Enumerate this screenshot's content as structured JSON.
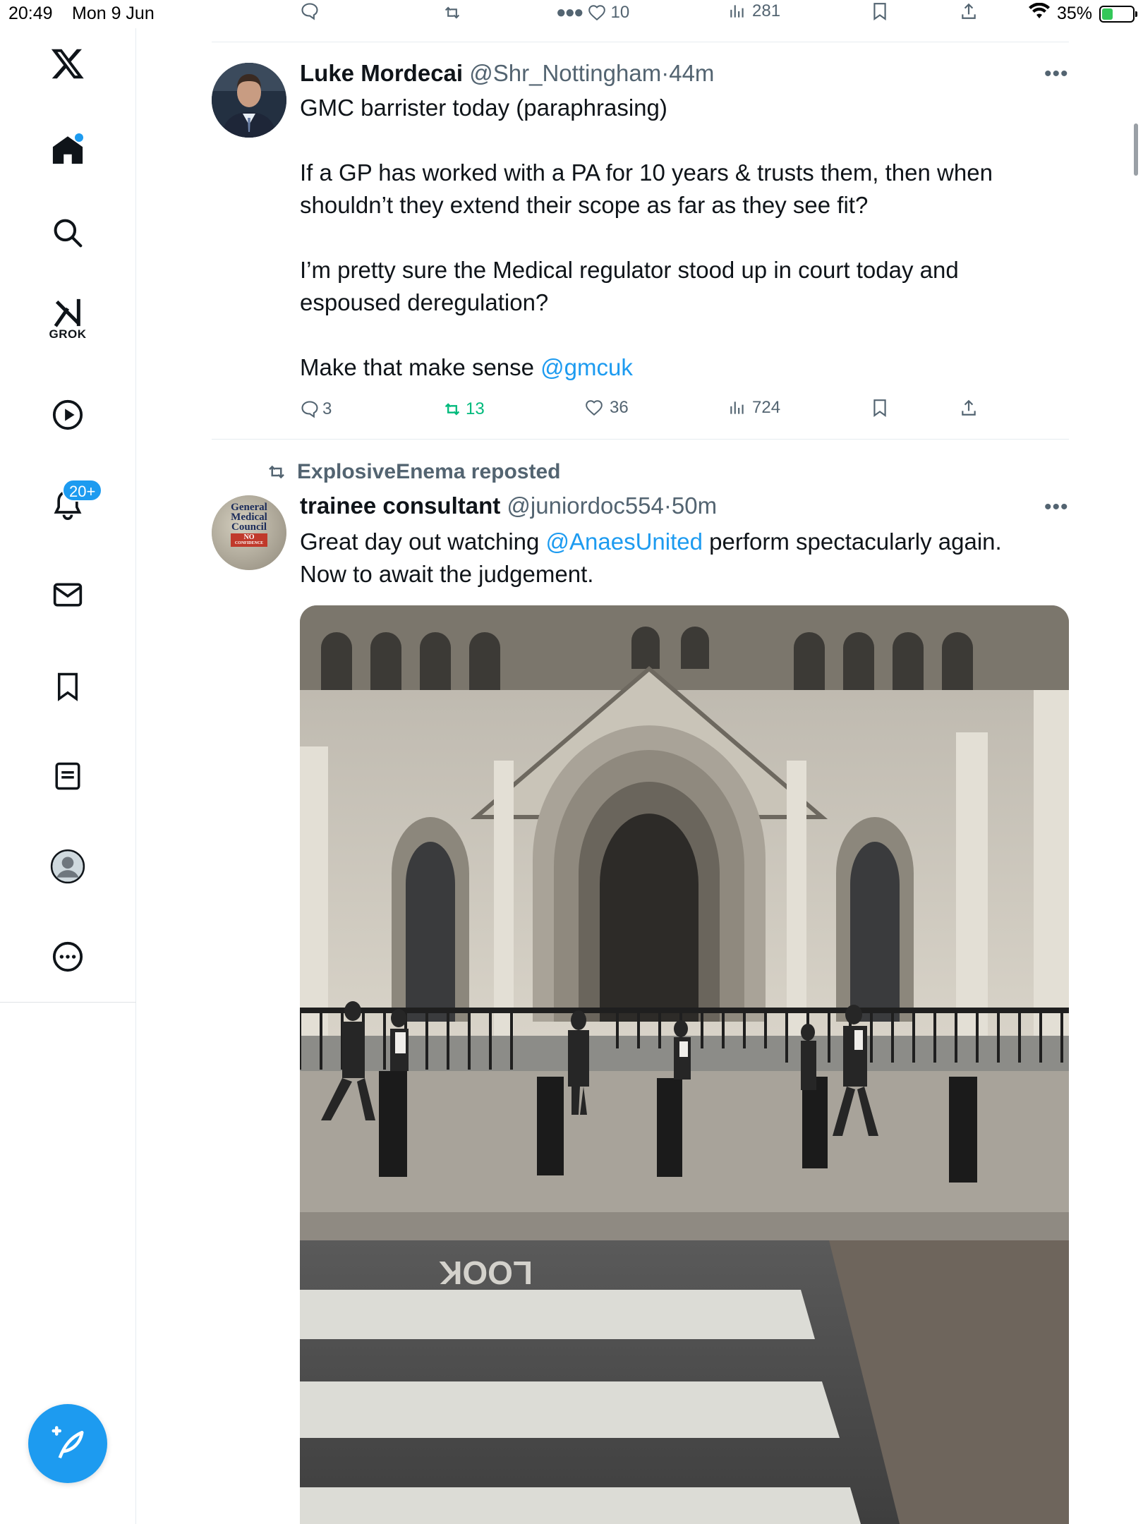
{
  "status_bar": {
    "time": "20:49",
    "date": "Mon 9 Jun",
    "battery": "35%",
    "battery_level": 0.35
  },
  "sidebar": {
    "items": [
      {
        "icon": "x-logo-icon"
      },
      {
        "icon": "home-icon",
        "has_dot": true
      },
      {
        "icon": "search-icon"
      },
      {
        "icon": "grok-icon",
        "label": "GROK"
      },
      {
        "icon": "video-icon"
      },
      {
        "icon": "notifications-icon",
        "badge": "20+"
      },
      {
        "icon": "messages-icon"
      },
      {
        "icon": "bookmarks-icon"
      },
      {
        "icon": "lists-icon"
      },
      {
        "icon": "profile-icon"
      },
      {
        "icon": "more-icon"
      }
    ],
    "compose_icon": "compose-icon"
  },
  "top_actions": {
    "likes": "10",
    "views": "281"
  },
  "tweets": [
    {
      "name": "Luke Mordecai",
      "handle": "@Shr_Nottingham",
      "dot": "·",
      "time": "44m",
      "text_main": "GMC barrister today (paraphrasing)\n\nIf a GP has worked with a PA for 10 years & trusts them, then when shouldn’t they extend their scope as far as they see fit?\n\nI’m pretty sure the Medical regulator stood up in court today and espoused deregulation?\n\nMake that make sense ",
      "mention": "@gmcuk",
      "replies": "3",
      "reposts": "13",
      "likes": "36",
      "views": "724"
    },
    {
      "reposted_by": "ExplosiveEnema reposted",
      "name": "trainee consultant",
      "handle": "@juniordoc554",
      "dot": "·",
      "time": "50m",
      "text_before": "Great day out watching ",
      "mention": "@AnaesUnited",
      "text_after": " perform spectacularly again.\nNow to await the judgement.",
      "avatar_lines": [
        "General",
        "Medical",
        "Council",
        "NO",
        "CONFIDENCE"
      ],
      "photo": {
        "road_marking": "LOOK"
      }
    }
  ],
  "colors": {
    "accent": "#1d9bf0",
    "repost_green": "#00ba7c",
    "muted": "#536471"
  }
}
